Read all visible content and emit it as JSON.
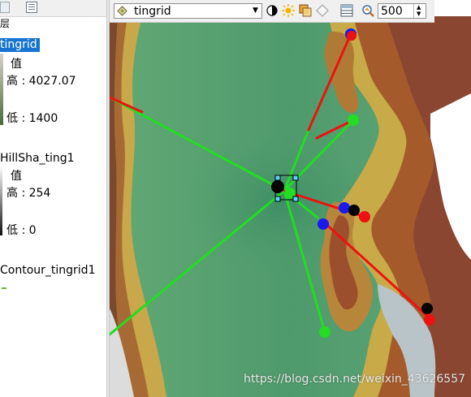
{
  "toc": {
    "layers_label": "层",
    "layers": [
      {
        "name": "tingrid",
        "selected": true,
        "value_label": "值",
        "high": "高 : 4027.07",
        "low": "低 : 1400"
      },
      {
        "name": "HillSha_ting1",
        "selected": false,
        "value_label": "值",
        "high": "高 : 254",
        "low": "低 : 0"
      },
      {
        "name": "Contour_tingrid1",
        "selected": false
      }
    ]
  },
  "toolbar": {
    "layer_select": {
      "value": "tingrid",
      "icon": "layer-diamond-icon"
    },
    "tools": [
      "contrast-icon",
      "brightness-icon",
      "transparency-icon",
      "swipe-icon",
      "table-icon",
      "zoom-scale-icon"
    ],
    "zoom_value": "500"
  },
  "watermark": "https://blog.csdn.net/weixin_43626557",
  "colors": {
    "selection": "#1874d2",
    "line_green": "#22dd22",
    "line_red": "#ee1111",
    "point_blue": "#1a1aee",
    "point_black": "#000000",
    "lowland_green": "#5aa06a",
    "highland_brown": "#a0542a"
  }
}
